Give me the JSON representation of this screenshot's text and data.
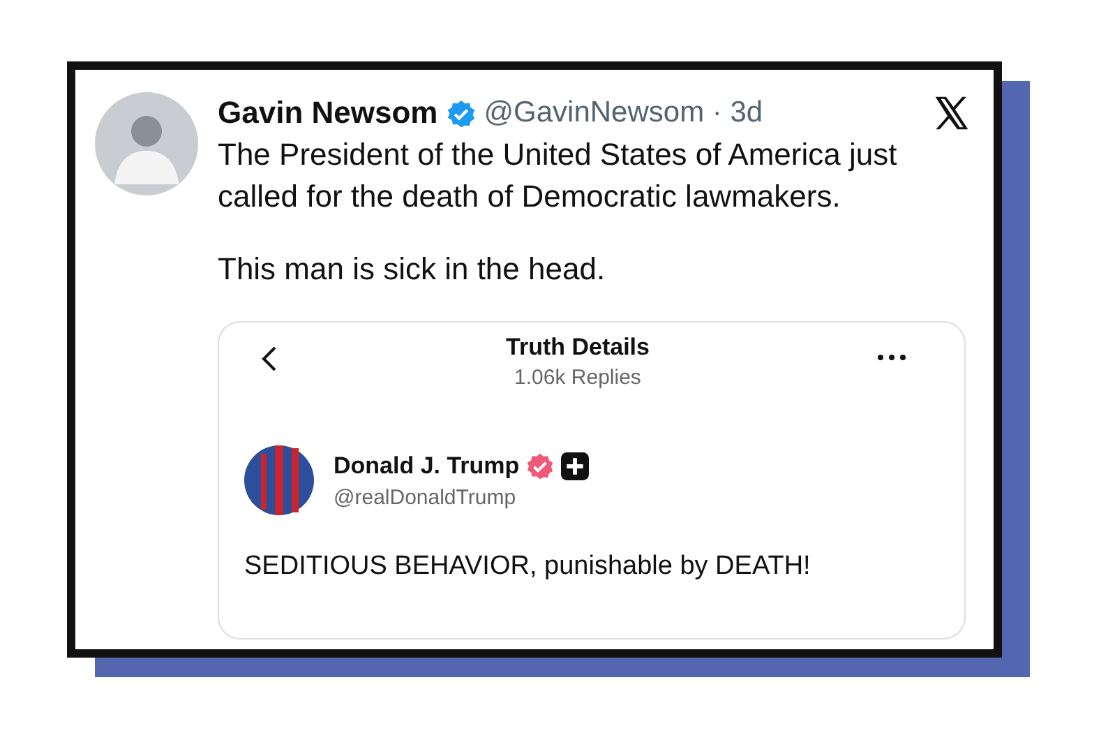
{
  "tweet": {
    "author": "Gavin Newsom",
    "meta": "@GavinNewsom · 3d",
    "paragraphs": [
      "The President of the United States of America just called for the death of Democratic lawmakers.",
      "This man is sick in the head."
    ],
    "quote": {
      "title": "Truth Details",
      "subtitle": "1.06k Replies",
      "author": "Donald J. Trump",
      "handle": "@realDonaldTrump",
      "text": "SEDITIOUS BEHAVIOR, punishable by DEATH!"
    }
  }
}
